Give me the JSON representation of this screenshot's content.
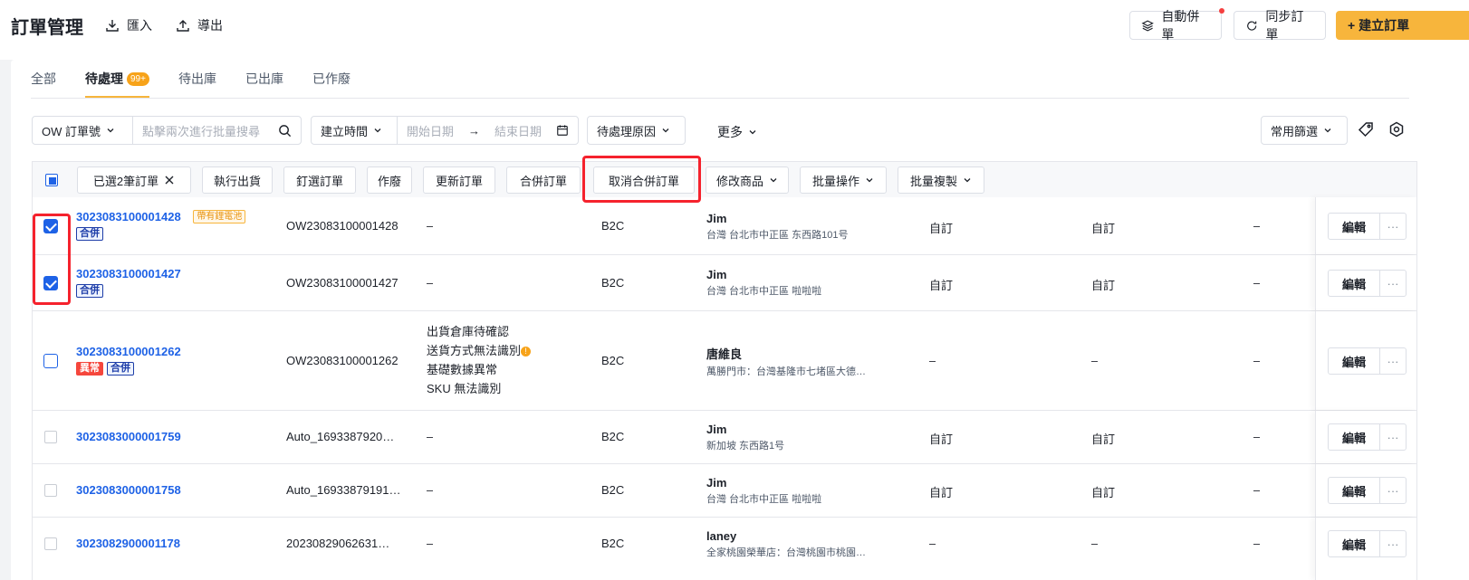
{
  "header": {
    "title": "訂單管理",
    "import_label": "匯入",
    "export_label": "導出",
    "auto_merge_label": "自動併單",
    "sync_label": "同步訂單",
    "create_label": "+ 建立訂單"
  },
  "tabs": [
    {
      "label": "全部"
    },
    {
      "label": "待處理",
      "badge": "99+"
    },
    {
      "label": "待出庫"
    },
    {
      "label": "已出庫"
    },
    {
      "label": "已作廢"
    }
  ],
  "filters": {
    "order_field": "OW 訂單號",
    "search_placeholder": "點擊兩次進行批量搜尋",
    "time_field": "建立時間",
    "start_placeholder": "開始日期",
    "end_placeholder": "結束日期",
    "date_arrow": "→",
    "pending_reason": "待處理原因",
    "more": "更多",
    "common_filter": "常用篩選"
  },
  "bulk": {
    "selected": "已選2筆訂單",
    "ship": "執行出貨",
    "choose": "釘選訂單",
    "void": "作廢",
    "update": "更新訂單",
    "merge": "合併訂單",
    "unmerge": "取消合併訂單",
    "modify_goods": "修改商品",
    "batch_ops": "批量操作",
    "batch_copy": "批量複製"
  },
  "row_actions": {
    "edit": "編輯",
    "more": "···"
  },
  "rows": [
    {
      "order": "3023083100001428",
      "tags": [
        "合併"
      ],
      "battery_tag": "帶有鋰電池",
      "ow": "OW23083100001428",
      "reason": "–",
      "type": "B2C",
      "name": "Jim",
      "addr": "台灣 台北市中正區 东西路101号",
      "c1": "自訂",
      "c2": "自訂",
      "c3": "–"
    },
    {
      "order": "3023083100001427",
      "tags": [
        "合併"
      ],
      "ow": "OW23083100001427",
      "reason": "–",
      "type": "B2C",
      "name": "Jim",
      "addr": "台灣 台北市中正區 啦啦啦",
      "c1": "自訂",
      "c2": "自訂",
      "c3": "–"
    },
    {
      "order": "3023083100001262",
      "tags": [
        "異常",
        "合併"
      ],
      "ow": "OW23083100001262",
      "reasons": [
        "出貨倉庫待確認",
        "送貨方式無法識別",
        "基礎數據異常",
        "SKU 無法識別"
      ],
      "warn": "!",
      "type": "B2C",
      "name": "唐維良",
      "addr": "萬勝門市：台灣基隆市七堵區大德…",
      "c1": "–",
      "c2": "–",
      "c3": "–"
    },
    {
      "order": "3023083000001759",
      "ow": "Auto_1693387920…",
      "reason": "–",
      "type": "B2C",
      "name": "Jim",
      "addr": "新加坡 东西路1号",
      "c1": "自訂",
      "c2": "自訂",
      "c3": "–"
    },
    {
      "order": "3023083000001758",
      "ow": "Auto_16933879191…",
      "reason": "–",
      "type": "B2C",
      "name": "Jim",
      "addr": "台灣 台北市中正區 啦啦啦",
      "c1": "自訂",
      "c2": "自訂",
      "c3": "–"
    },
    {
      "order": "3023082900001178",
      "ow": "20230829062631…",
      "reason": "–",
      "type": "B2C",
      "name": "laney",
      "addr": "全家桃園榮華店：台灣桃園市桃園…",
      "c1": "–",
      "c2": "–",
      "c3": "–"
    }
  ]
}
